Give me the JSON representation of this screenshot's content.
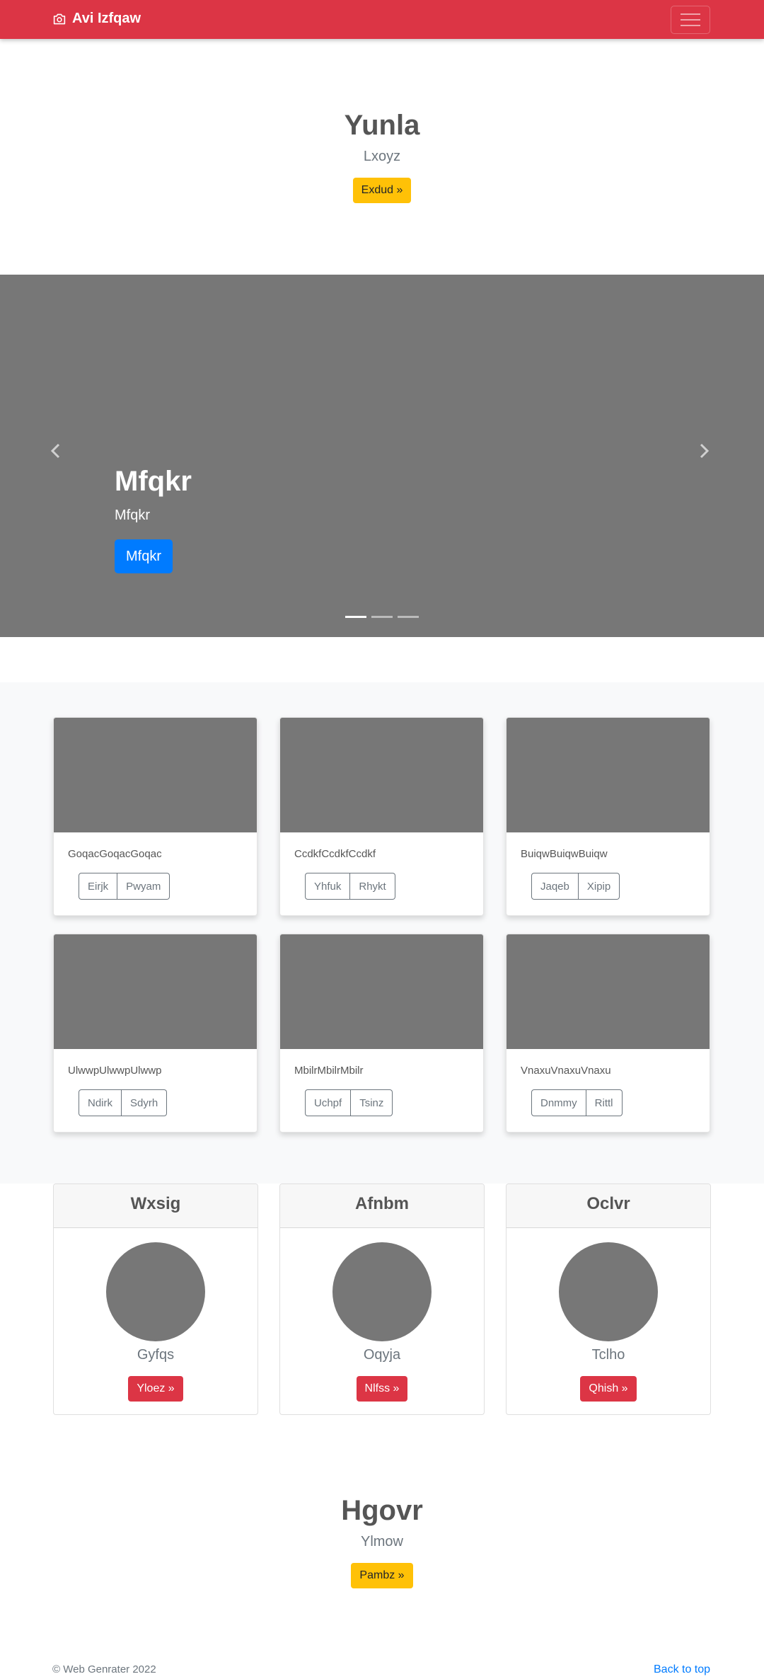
{
  "navbar": {
    "brand": "Avi Izfqaw",
    "brand_icon": "camera-icon",
    "toggler_icon": "hamburger-menu-icon",
    "bg_color": "#dc3545"
  },
  "hero1": {
    "title": "Yunla",
    "subtitle": "Lxoyz",
    "button": "Exdud »"
  },
  "carousel": {
    "title": "Mfqkr",
    "subtitle": "Mfqkr",
    "button": "Mfqkr",
    "prev_icon": "chevron-left-icon",
    "next_icon": "chevron-right-icon",
    "slide_count": 3,
    "active_index": 0
  },
  "album": {
    "cards": [
      {
        "text": "GoqacGoqacGoqac",
        "buttons": [
          "Eirjk",
          "Pwyam"
        ]
      },
      {
        "text": "CcdkfCcdkfCcdkf",
        "buttons": [
          "Yhfuk",
          "Rhykt"
        ]
      },
      {
        "text": "BuiqwBuiqwBuiqw",
        "buttons": [
          "Jaqeb",
          "Xipip"
        ]
      },
      {
        "text": "UlwwpUlwwpUlwwp",
        "buttons": [
          "Ndirk",
          "Sdyrh"
        ]
      },
      {
        "text": "MbilrMbilrMbilr",
        "buttons": [
          "Uchpf",
          "Tsinz"
        ]
      },
      {
        "text": "VnaxuVnaxuVnaxu",
        "buttons": [
          "Dnmmy",
          "Rittl"
        ]
      }
    ]
  },
  "pricing": [
    {
      "header": "Wxsig",
      "name": "Gyfqs",
      "button": "Yloez »"
    },
    {
      "header": "Afnbm",
      "name": "Oqyja",
      "button": "Nlfss »"
    },
    {
      "header": "Oclvr",
      "name": "Tclho",
      "button": "Qhish »"
    }
  ],
  "hero2": {
    "title": "Hgovr",
    "subtitle": "Ylmow",
    "button": "Pambz »"
  },
  "footer": {
    "copyright": "© Web Genrater 2022",
    "back_to_top": "Back to top"
  }
}
